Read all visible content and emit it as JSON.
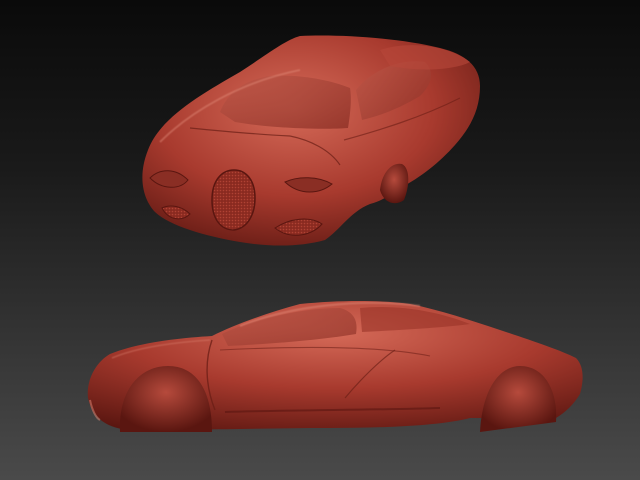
{
  "scene": {
    "background_top": "#0a0a0a",
    "background_bottom": "#4a4a4a",
    "clay_base": "#a83a2e",
    "clay_highlight": "#d56a58",
    "clay_shadow": "#5a1610",
    "clay_rim": "#e08a78"
  },
  "models": [
    {
      "name": "car-sculpt-front-three-quarter-view"
    },
    {
      "name": "car-sculpt-side-view"
    }
  ]
}
